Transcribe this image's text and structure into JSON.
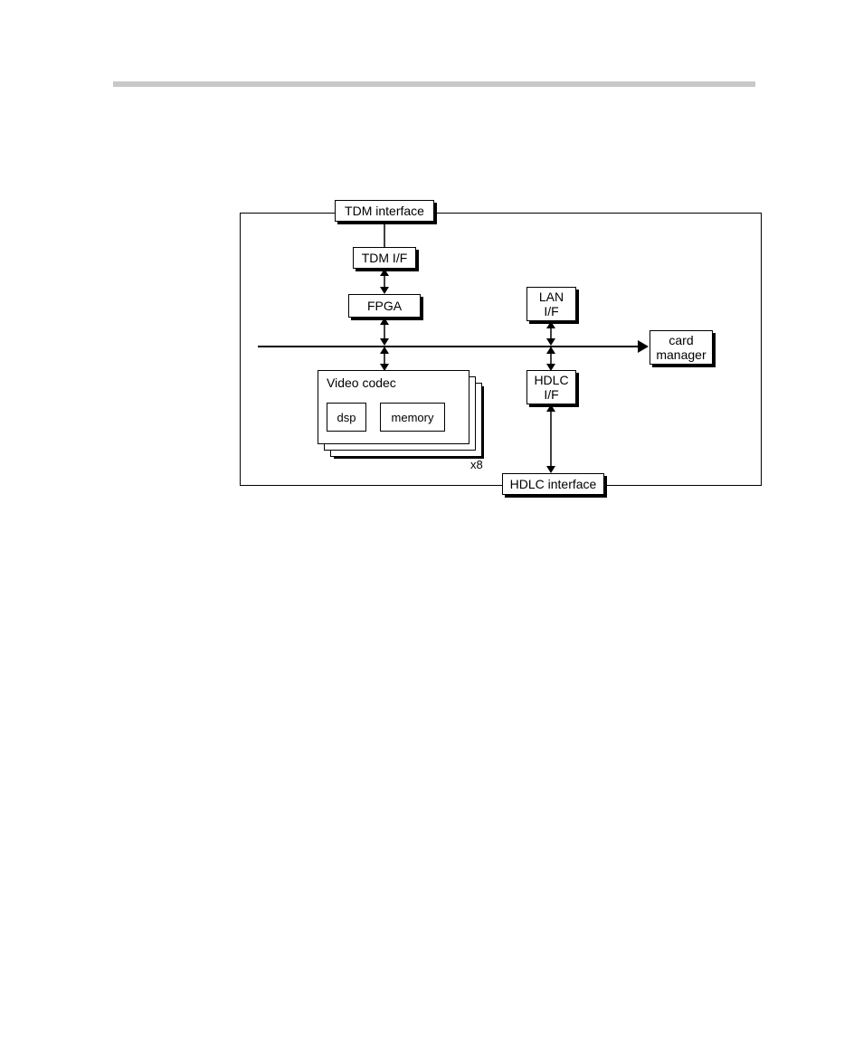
{
  "diagram": {
    "tdm_interface": "TDM interface",
    "tdm_if": "TDM I/F",
    "fpga": "FPGA",
    "lan_if_line1": "LAN",
    "lan_if_line2": "I/F",
    "card_manager_line1": "card",
    "card_manager_line2": "manager",
    "video_codec": "Video codec",
    "dsp": "dsp",
    "memory": "memory",
    "x8": "x8",
    "hdlc_if_line1": "HDLC",
    "hdlc_if_line2": "I/F",
    "hdlc_interface": "HDLC interface"
  }
}
